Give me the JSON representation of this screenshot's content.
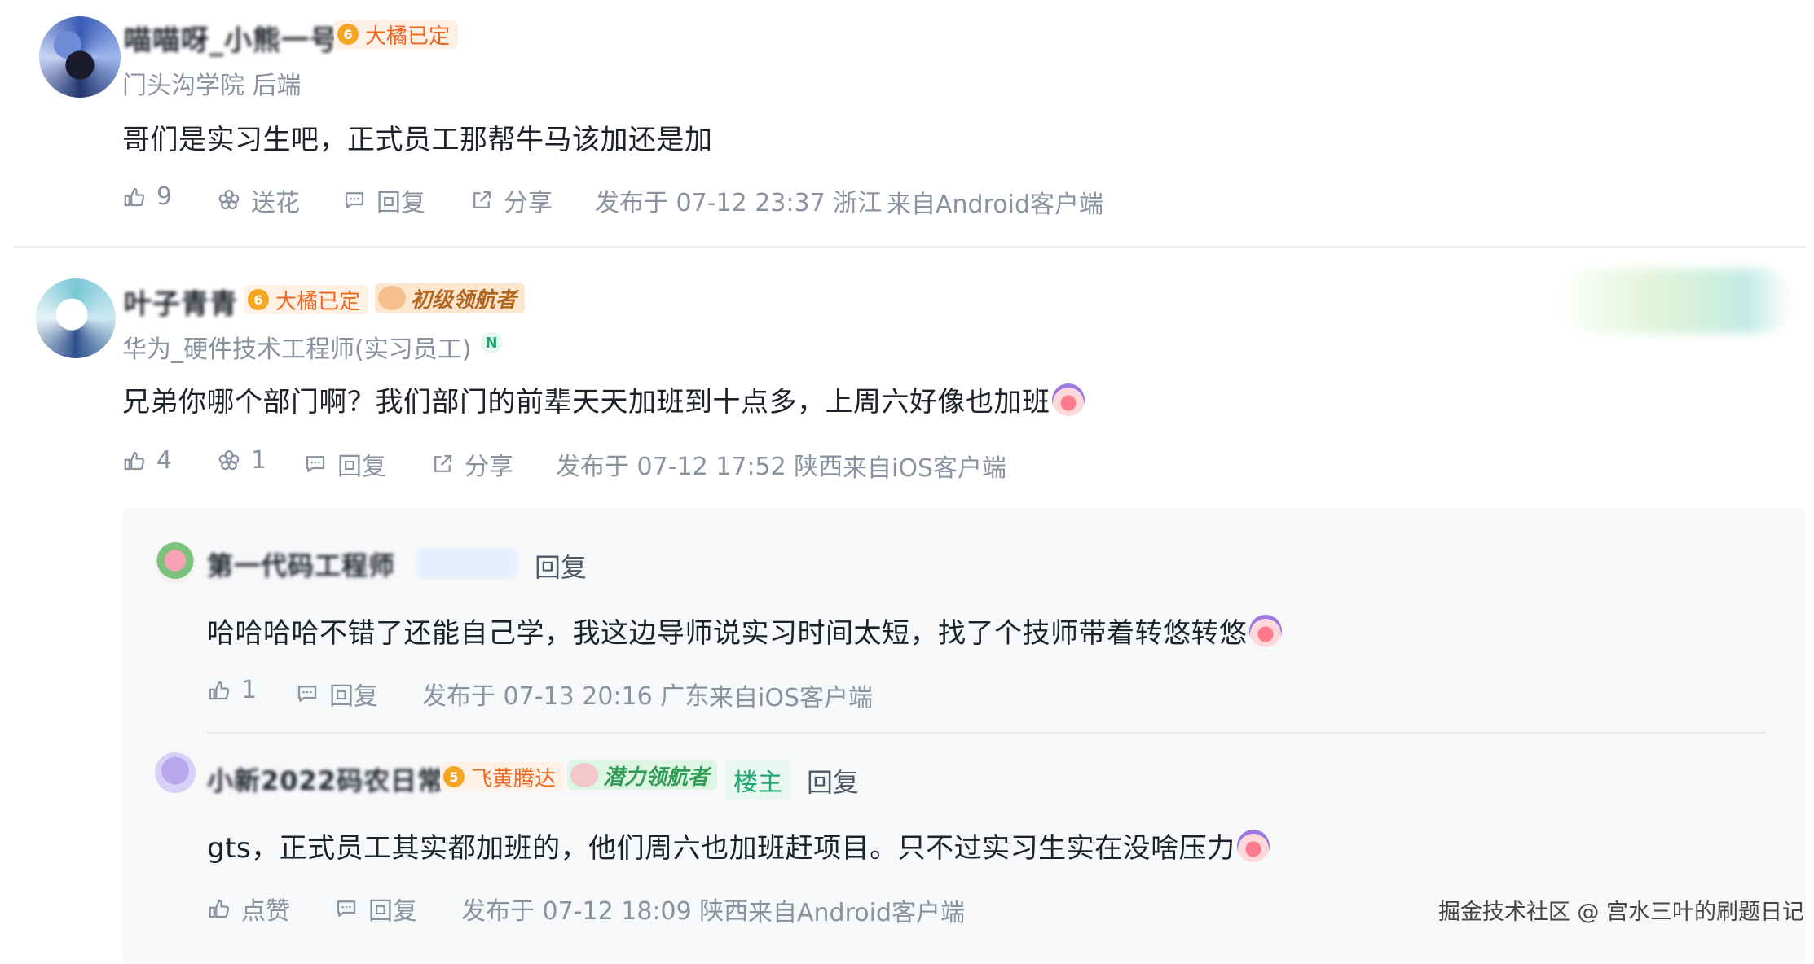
{
  "comments": [
    {
      "username": "喵喵呀_小熊一号",
      "level": "6",
      "level_title": "大橘已定",
      "subtitle": "门头沟学院 后端",
      "content": "哥们是实习生吧，正式员工那帮牛马该加还是加",
      "likes": "9",
      "flower_label": "送花",
      "reply_label": "回复",
      "share_label": "分享",
      "published": "发布于 07-12 23:37 浙江",
      "client": "来自Android客户端"
    },
    {
      "username": "叶子青青",
      "level": "6",
      "level_title": "大橘已定",
      "nav_badge": "初级领航者",
      "subtitle": "华为_硬件技术工程师(实习员工)",
      "subtitle_badge": "N",
      "content": "兄弟你哪个部门啊？我们部门的前辈天天加班到十点多，上周六好像也加班",
      "likes": "4",
      "flowers": "1",
      "reply_label": "回复",
      "share_label": "分享",
      "published": "发布于 07-12 17:52 陕西",
      "client": "来自iOS客户端"
    }
  ],
  "replies": [
    {
      "username": "第一代码工程师",
      "reply_word": "回复",
      "content": "哈哈哈哈不错了还能自己学，我这边导师说实习时间太短，找了个技师带着转悠转悠",
      "likes": "1",
      "reply_label": "回复",
      "published": "发布于 07-13 20:16 广东",
      "client": "来自iOS客户端"
    },
    {
      "username": "小新2022码农日常",
      "level": "5",
      "level_title": "飞黄腾达",
      "nav_badge": "潜力领航者",
      "owner_label": "楼主",
      "reply_word": "回复",
      "content": "gts，正式员工其实都加班的，他们周六也加班赶项目。只不过实习生实在没啥压力",
      "like_label": "点赞",
      "reply_label": "回复",
      "published": "发布于 07-12 18:09 陕西",
      "client": "来自Android客户端"
    }
  ],
  "watermark": "掘金技术社区 @ 宫水三叶的刷题日记"
}
